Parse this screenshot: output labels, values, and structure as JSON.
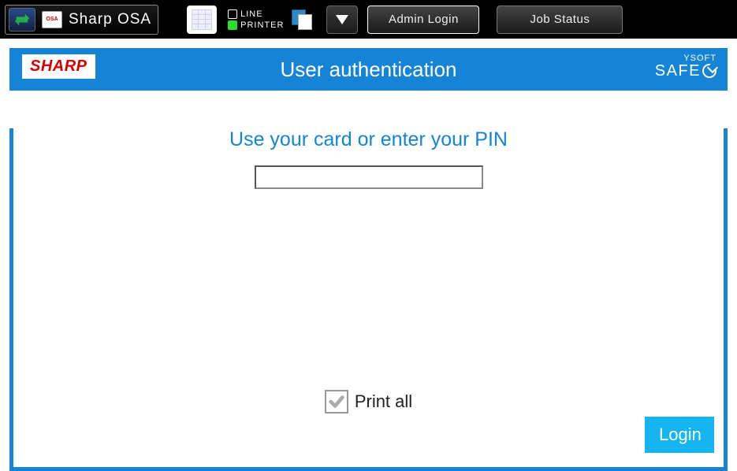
{
  "topbar": {
    "app_title": "Sharp OSA",
    "osa_chip": "OSA",
    "status_line": "LINE",
    "status_printer": "PRINTER",
    "admin_login": "Admin Login",
    "job_status": "Job Status"
  },
  "title": "User authentication",
  "brands": {
    "sharp": "SHARP",
    "ysoft_top": "YSOFT",
    "ysoft_bottom": "SAFE"
  },
  "main": {
    "prompt": "Use your card or enter your PIN",
    "pin_value": "",
    "print_all_label": "Print all",
    "print_all_checked": true,
    "login_label": "Login"
  },
  "colors": {
    "brand_blue": "#1584d7",
    "accent_cyan": "#14b5f0",
    "sharp_red": "#d60000"
  }
}
